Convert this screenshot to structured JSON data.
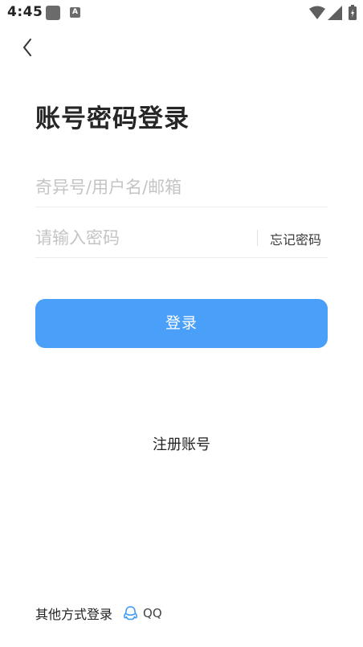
{
  "status_bar": {
    "time": "4:45",
    "notification_icon_letter": "A",
    "icons": [
      "notification-square-icon",
      "a-notification-icon",
      "wifi-icon",
      "cell-signal-icon",
      "battery-charging-icon"
    ]
  },
  "nav": {
    "back_icon": "chevron-left-icon"
  },
  "title": "账号密码登录",
  "form": {
    "account_placeholder": "奇异号/用户名/邮箱",
    "account_value": "",
    "password_placeholder": "请输入密码",
    "password_value": "",
    "forgot_label": "忘记密码",
    "login_label": "登录"
  },
  "register_label": "注册账号",
  "other_login": {
    "label": "其他方式登录",
    "options": [
      {
        "icon": "qq-icon",
        "label": "QQ"
      }
    ]
  },
  "colors": {
    "accent": "#4a9ff9",
    "qq_icon": "#3b9bf5",
    "placeholder": "#c4c4c4"
  }
}
